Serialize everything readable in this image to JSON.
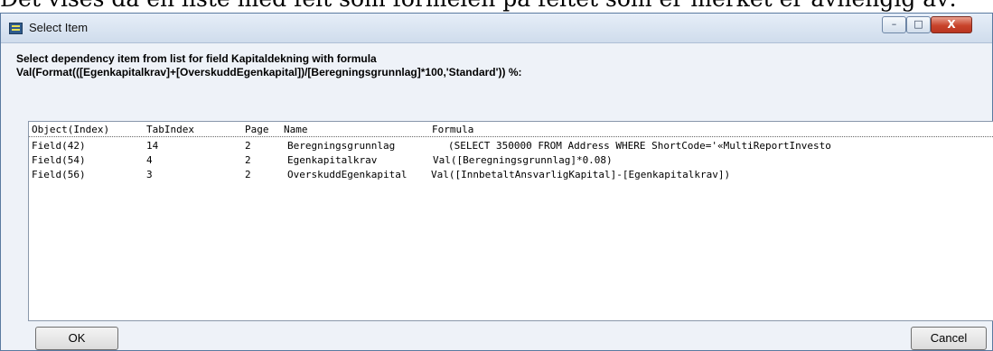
{
  "document": {
    "text": "Det vises da en liste med felt som formelen på feltet som er merket er avhengig av:"
  },
  "window": {
    "title": "Select Item",
    "controls": {
      "minimize": "–",
      "maximize": "□",
      "close": "X"
    }
  },
  "prompt": {
    "line1": "Select dependency item from list for field Kapitaldekning with formula",
    "line2": "Val(Format(([Egenkapitalkrav]+[OverskuddEgenkapital])/[Beregningsgrunnlag]*100,'Standard')) %:"
  },
  "list": {
    "columns": [
      "Object(Index)",
      "TabIndex",
      "Page",
      "Name",
      "Formula"
    ],
    "rows": [
      {
        "object": "Field(42)",
        "tabindex": "14",
        "page": "2",
        "name": "Beregningsgrunnlag",
        "formula": "(SELECT 350000 FROM Address WHERE ShortCode='«MultiReportInvesto"
      },
      {
        "object": "Field(54)",
        "tabindex": "4",
        "page": "2",
        "name": "Egenkapitalkrav",
        "formula": "Val([Beregningsgrunnlag]*0.08)"
      },
      {
        "object": "Field(56)",
        "tabindex": "3",
        "page": "2",
        "name": "OverskuddEgenkapital",
        "formula": "Val([InnbetaltAnsvarligKapital]-[Egenkapitalkrav])"
      }
    ]
  },
  "buttons": {
    "ok": "OK",
    "cancel": "Cancel"
  }
}
